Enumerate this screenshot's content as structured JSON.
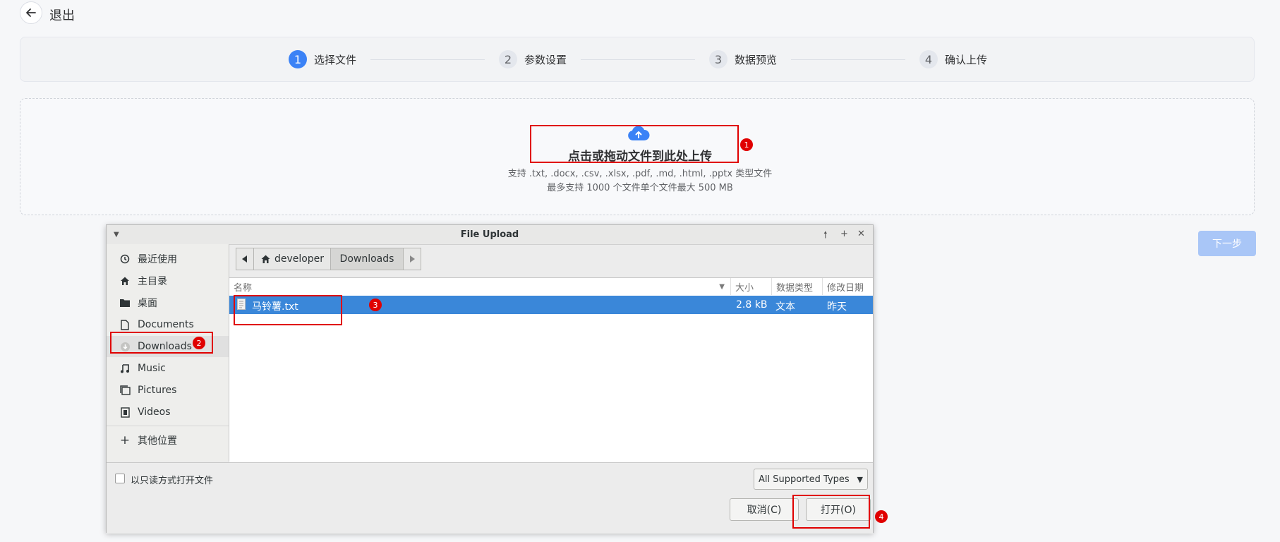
{
  "header": {
    "back_label": "退出"
  },
  "steps": [
    {
      "num": "1",
      "label": "选择文件"
    },
    {
      "num": "2",
      "label": "参数设置"
    },
    {
      "num": "3",
      "label": "数据预览"
    },
    {
      "num": "4",
      "label": "确认上传"
    }
  ],
  "upload": {
    "title": "点击或拖动文件到此处上传",
    "formats": "支持 .txt, .docx, .csv, .xlsx, .pdf, .md, .html, .pptx 类型文件",
    "limits": "最多支持 1000 个文件单个文件最大 500 MB"
  },
  "next_button": "下一步",
  "annotations": [
    "1",
    "2",
    "3",
    "4"
  ],
  "dialog": {
    "title": "File Upload",
    "sidebar": [
      {
        "label": "最近使用",
        "icon": "clock-icon"
      },
      {
        "label": "主目录",
        "icon": "home-icon"
      },
      {
        "label": "桌面",
        "icon": "folder-icon"
      },
      {
        "label": "Documents",
        "icon": "document-icon"
      },
      {
        "label": "Downloads",
        "icon": "download-icon"
      },
      {
        "label": "Music",
        "icon": "music-icon"
      },
      {
        "label": "Pictures",
        "icon": "pictures-icon"
      },
      {
        "label": "Videos",
        "icon": "videos-icon"
      },
      {
        "label": "其他位置",
        "icon": "plus-icon"
      }
    ],
    "path": [
      "developer",
      "Downloads"
    ],
    "columns": {
      "name": "名称",
      "size": "大小",
      "type": "数据类型",
      "modified": "修改日期"
    },
    "files": [
      {
        "name": "马铃薯.txt",
        "size": "2.8 kB",
        "type": "文本",
        "modified": "昨天"
      }
    ],
    "readonly_label": "以只读方式打开文件",
    "filter": "All Supported Types",
    "cancel": "取消(C)",
    "open": "打开(O)"
  },
  "colors": {
    "accent": "#3b82f6",
    "annotation": "#e00000",
    "selection": "#3a87d9"
  }
}
